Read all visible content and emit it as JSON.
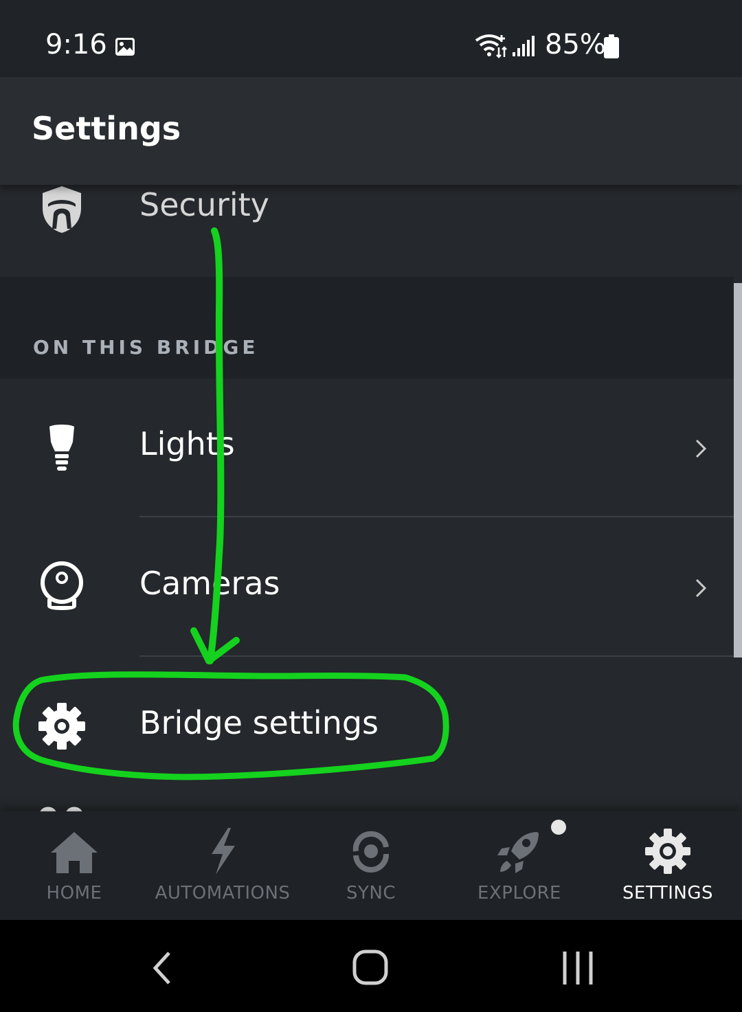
{
  "status_bar": {
    "time": "9:16",
    "battery": "85%",
    "icons": [
      "image-icon",
      "wifi-icon",
      "signal-icon",
      "battery-icon"
    ]
  },
  "app_bar": {
    "title": "Settings"
  },
  "security": {
    "label": "Security",
    "icon": "security-shield-icon"
  },
  "section": {
    "title": "ON THIS BRIDGE"
  },
  "rows": {
    "lights": {
      "label": "Lights",
      "icon": "bulb-icon"
    },
    "cameras": {
      "label": "Cameras",
      "icon": "camera-icon"
    },
    "bridge_settings": {
      "label": "Bridge settings",
      "icon": "gear-icon"
    }
  },
  "bottom_nav": {
    "home": "HOME",
    "automations": "AUTOMATIONS",
    "sync": "SYNC",
    "explore": "EXPLORE",
    "settings": "SETTINGS",
    "active": "settings"
  },
  "colors": {
    "background": "#25282c",
    "app_bar": "#2a2d31",
    "section_header": "#1e2125",
    "nav_inactive": "#6c7178",
    "nav_active": "#ffffff",
    "annotation": "#14d21e"
  }
}
